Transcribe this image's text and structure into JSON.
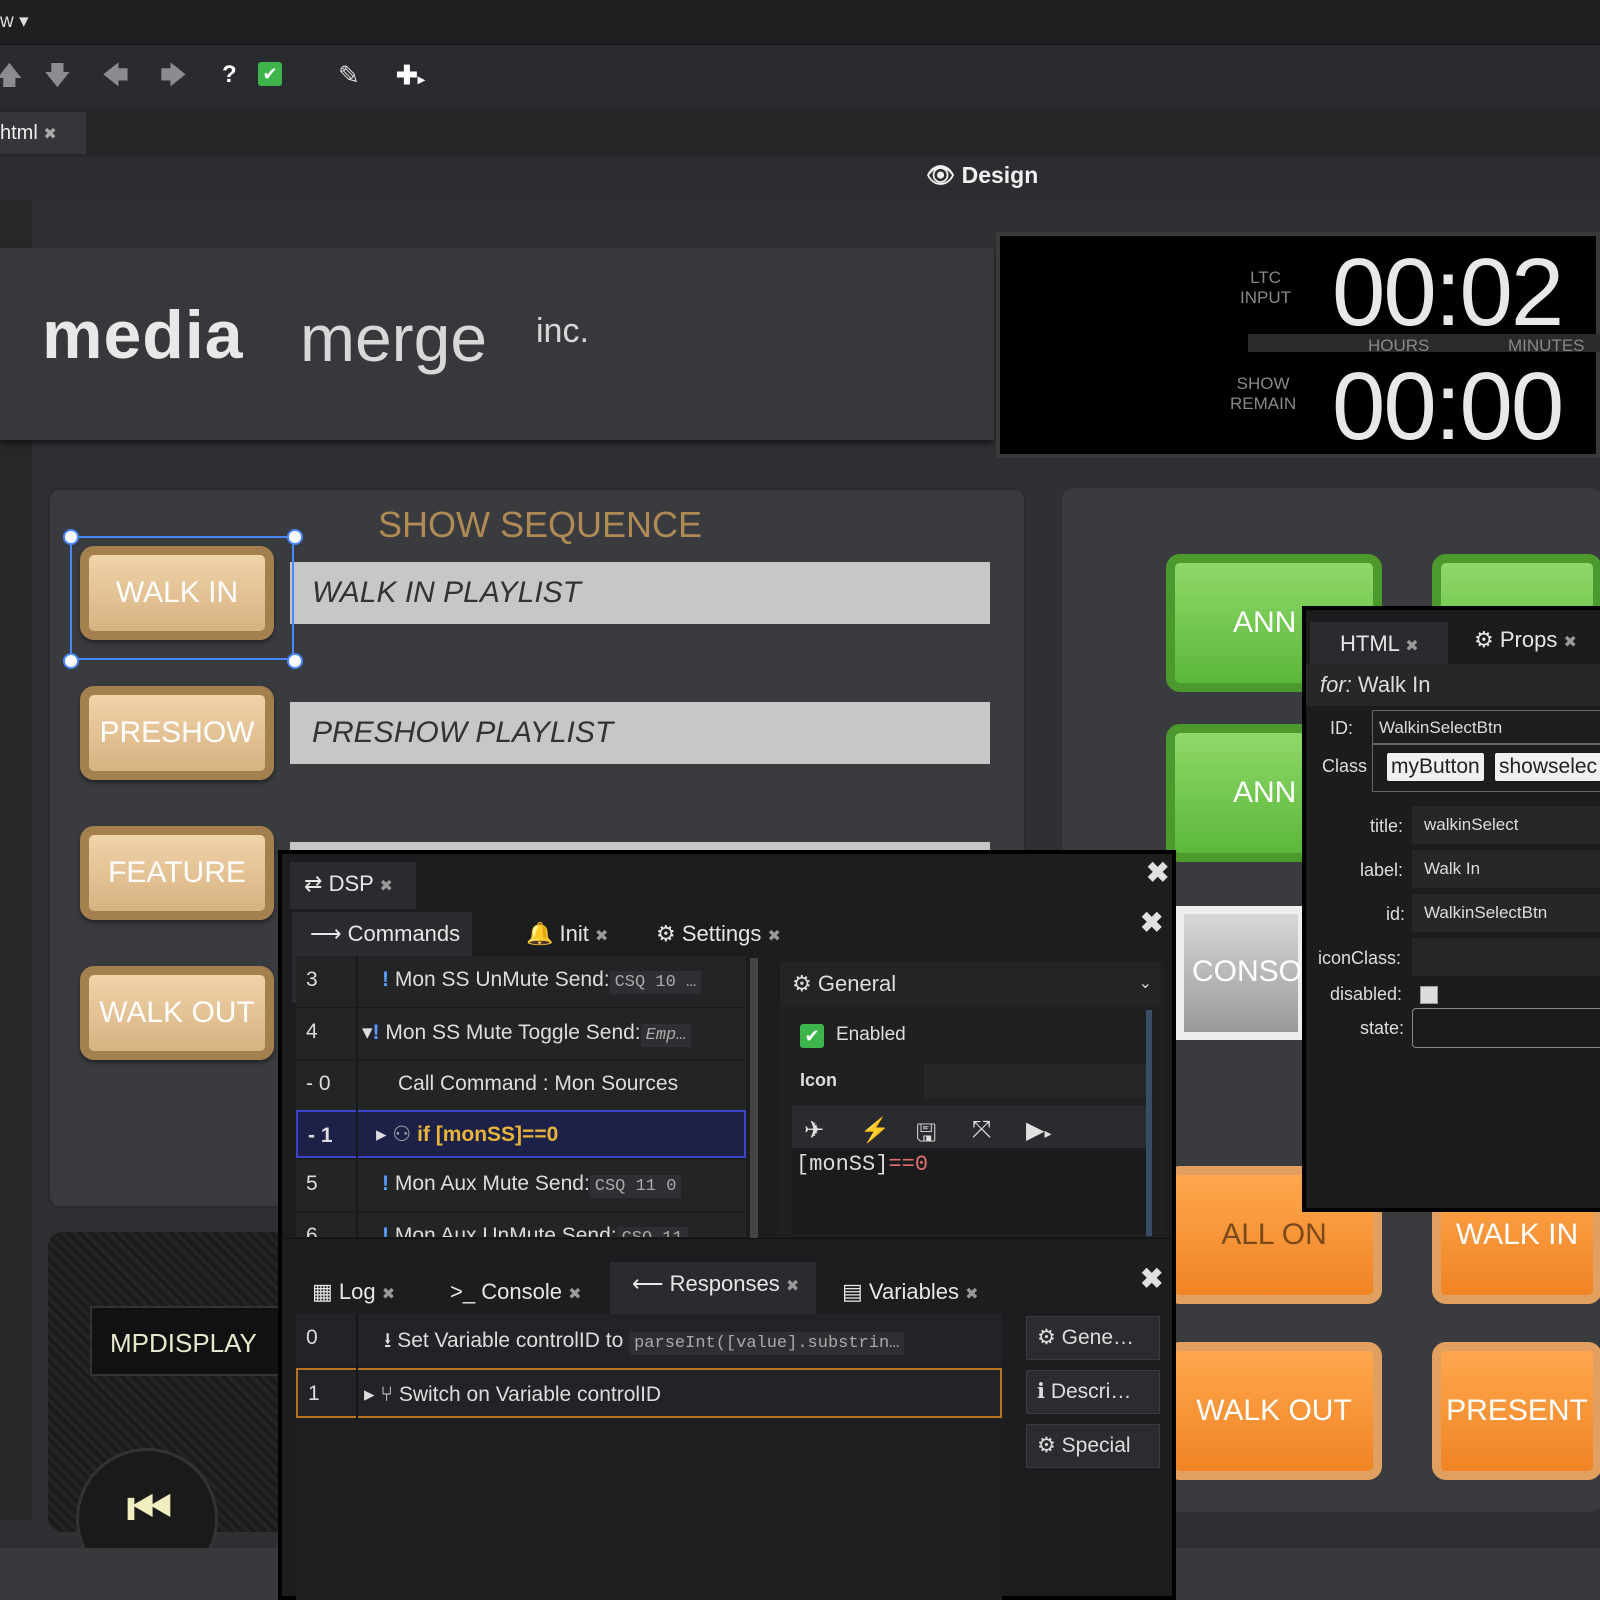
{
  "menubar": {
    "label": "w ▾"
  },
  "toolbar": {
    "icons": [
      "arrow-up-icon",
      "arrow-down-icon",
      "arrow-left-icon",
      "arrow-right-icon",
      "help-icon",
      "check-icon",
      "pencil-icon",
      "plus-icon"
    ]
  },
  "tabs": {
    "file_tab": "html",
    "close": "✖"
  },
  "view_mode": {
    "label": "Design"
  },
  "logo": {
    "media": "media",
    "merge": "merge",
    "inc": "inc."
  },
  "clock": {
    "ltc_label_1": "LTC",
    "ltc_label_2": "INPUT",
    "ltc_time": "00:02",
    "hours": "HOURS",
    "minutes": "MINUTES",
    "show_label_1": "SHOW",
    "show_label_2": "REMAIN",
    "show_time": "00:00"
  },
  "sequence": {
    "title": "SHOW SEQUENCE",
    "buttons": [
      "WALK IN",
      "PRESHOW",
      "FEATURE",
      "WALK OUT"
    ],
    "playlists": [
      "WALK IN PLAYLIST",
      "PRESHOW PLAYLIST"
    ]
  },
  "right_buttons": {
    "green": [
      "ANN",
      "ANN"
    ],
    "conso": "CONSO",
    "orange": [
      "ALL ON",
      "WALK IN",
      "WALK OUT",
      "PRESENT"
    ]
  },
  "mpdisplay": {
    "label": "MPDISPLAY"
  },
  "dsp": {
    "title": "DSP",
    "tabs": [
      "Commands",
      "Init",
      "Settings"
    ],
    "rows": [
      {
        "num": "3",
        "text": "Mon SS UnMute Send:",
        "code": "CSQ 10 …"
      },
      {
        "num": "4",
        "text": "Mon SS Mute Toggle Send:",
        "code": "Emp…"
      },
      {
        "num": "- 0",
        "text": "Call Command : Mon Sources",
        "code": ""
      },
      {
        "num": "- 1",
        "text": "if [monSS]==0",
        "code": ""
      },
      {
        "num": "5",
        "text": "Mon Aux Mute Send:",
        "code": "CSQ 11 0"
      },
      {
        "num": "6",
        "text": "Mon Aux UnMute Send:",
        "code": "CSQ 11"
      }
    ],
    "general": {
      "title": "General",
      "enabled": "Enabled",
      "icon": "Icon",
      "expr_var": "[monSS]",
      "expr_op": "==",
      "expr_val": "0"
    },
    "bottom_tabs": [
      "Log",
      "Console",
      "Responses",
      "Variables"
    ],
    "responses": [
      {
        "num": "0",
        "text": "Set Variable controlID to",
        "code": "parseInt([value].substrin…"
      },
      {
        "num": "1",
        "text": "Switch on Variable controlID",
        "code": ""
      }
    ],
    "side_buttons": [
      "Gene…",
      "Descri…",
      "Special"
    ]
  },
  "props": {
    "tabs": [
      "HTML",
      "Props"
    ],
    "for_label": "for:",
    "for_value": "Walk In",
    "id_label": "ID:",
    "id_value": "WalkinSelectBtn",
    "class_label": "Class",
    "classes": [
      "myButton",
      "showselec"
    ],
    "fields": [
      {
        "label": "title:",
        "value": "walkinSelect"
      },
      {
        "label": "label:",
        "value": "Walk In"
      },
      {
        "label": "id:",
        "value": "WalkinSelectBtn"
      },
      {
        "label": "iconClass:",
        "value": ""
      }
    ],
    "disabled_label": "disabled:",
    "state_label": "state:"
  }
}
